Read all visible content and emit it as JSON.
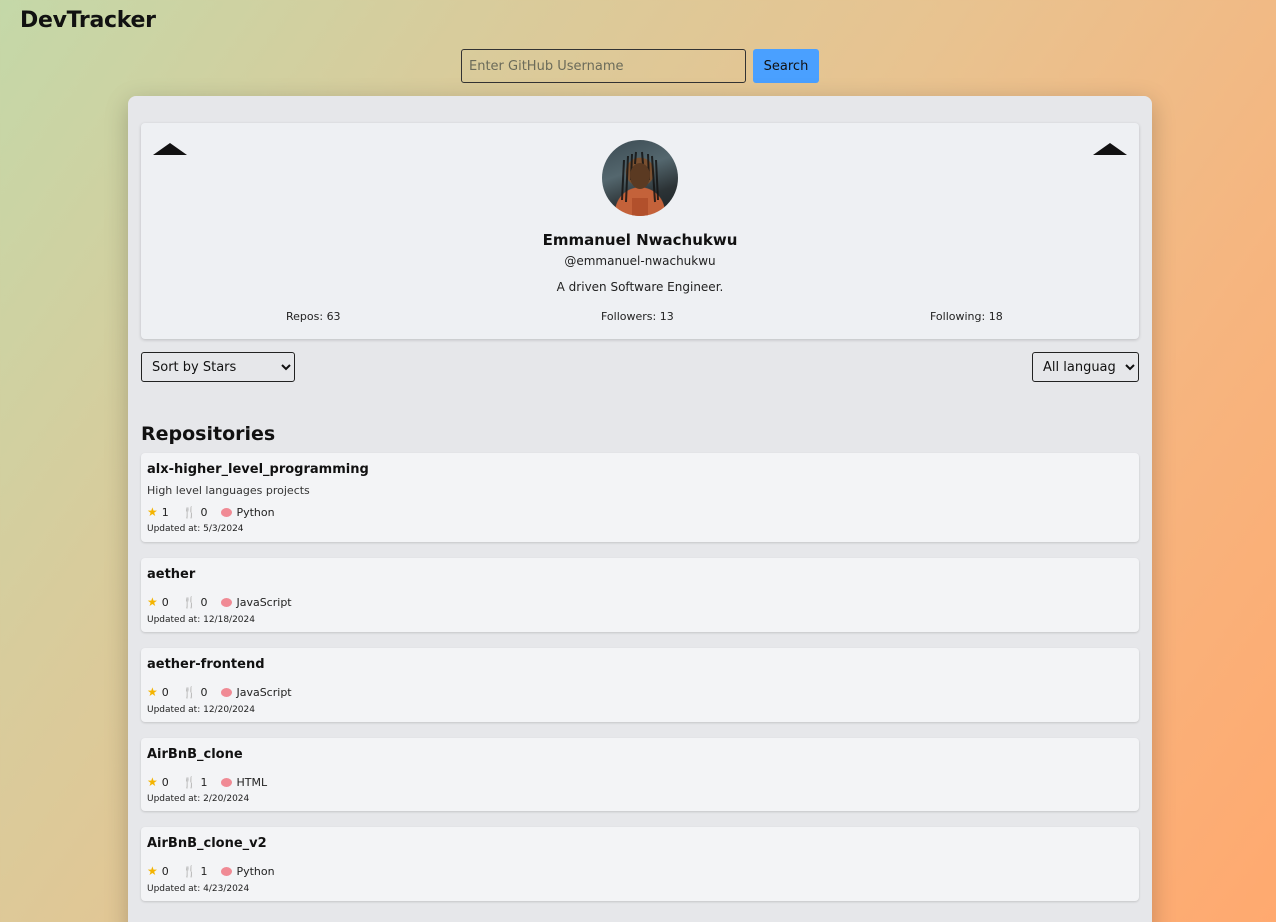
{
  "app": {
    "title": "DevTracker"
  },
  "search": {
    "placeholder": "Enter GitHub Username",
    "value": "",
    "button_label": "Search"
  },
  "profile": {
    "name": "Emmanuel Nwachukwu",
    "handle": "@emmanuel-nwachukwu",
    "bio": "A driven Software Engineer.",
    "repos_label": "Repos: 63",
    "followers_label": "Followers: 13",
    "following_label": "Following: 18"
  },
  "filters": {
    "sort_selected": "Sort by Stars",
    "language_selected": "All languages"
  },
  "repositories": {
    "heading": "Repositories",
    "items": [
      {
        "name": "alx-higher_level_programming",
        "description": "High level languages projects",
        "stars": "1",
        "forks": "0",
        "language": "Python",
        "updated": "Updated at: 5/3/2024"
      },
      {
        "name": "aether",
        "description": "",
        "stars": "0",
        "forks": "0",
        "language": "JavaScript",
        "updated": "Updated at: 12/18/2024"
      },
      {
        "name": "aether-frontend",
        "description": "",
        "stars": "0",
        "forks": "0",
        "language": "JavaScript",
        "updated": "Updated at: 12/20/2024"
      },
      {
        "name": "AirBnB_clone",
        "description": "",
        "stars": "0",
        "forks": "1",
        "language": "HTML",
        "updated": "Updated at: 2/20/2024"
      },
      {
        "name": "AirBnB_clone_v2",
        "description": "",
        "stars": "0",
        "forks": "1",
        "language": "Python",
        "updated": "Updated at: 4/23/2024"
      }
    ]
  },
  "icons": {
    "star": "star-icon",
    "fork": "fork-icon",
    "language": "brain-icon",
    "collapse": "triangle-up-icon"
  }
}
